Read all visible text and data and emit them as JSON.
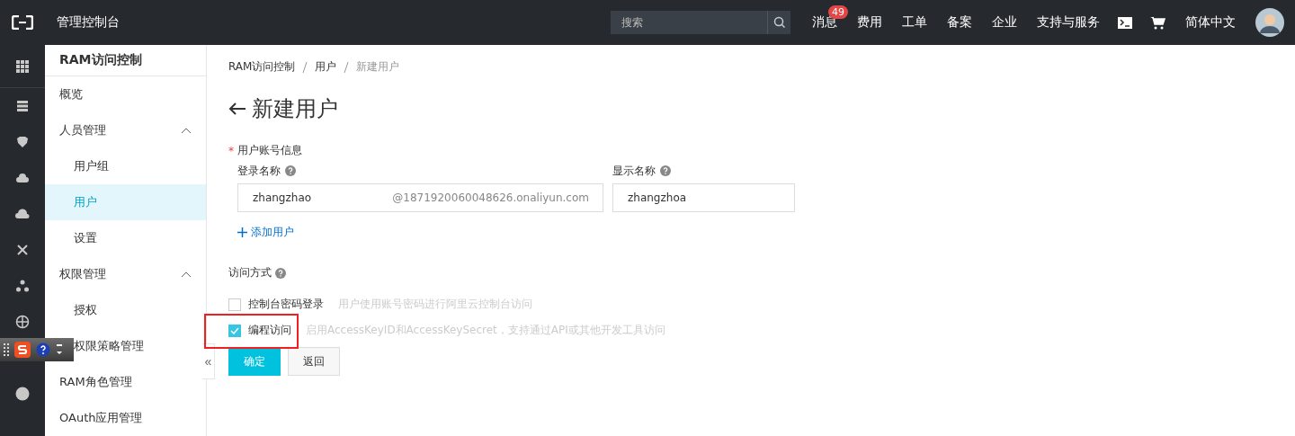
{
  "topbar": {
    "title": "管理控制台",
    "search": {
      "placeholder": "搜索"
    },
    "nav": [
      {
        "label": "消息",
        "badge": "49"
      },
      {
        "label": "费用"
      },
      {
        "label": "工单"
      },
      {
        "label": "备案"
      },
      {
        "label": "企业"
      },
      {
        "label": "支持与服务"
      }
    ],
    "language": "简体中文"
  },
  "sidebar": {
    "title": "RAM访问控制",
    "collapse": "«",
    "items": [
      {
        "label": "概览",
        "selected": false
      },
      {
        "label": "人员管理",
        "selected": false,
        "expanded": true,
        "children": [
          {
            "label": "用户组",
            "selected": false
          },
          {
            "label": "用户",
            "selected": true
          },
          {
            "label": "设置",
            "selected": false
          }
        ]
      },
      {
        "label": "权限管理",
        "selected": false,
        "expanded": true,
        "children": [
          {
            "label": "授权",
            "selected": false
          },
          {
            "label": "权限策略管理",
            "selected": false
          }
        ]
      },
      {
        "label": "RAM角色管理",
        "selected": false
      },
      {
        "label": "OAuth应用管理",
        "selected": false
      }
    ]
  },
  "breadcrumb": [
    "RAM访问控制",
    "用户",
    "新建用户"
  ],
  "page_title": "新建用户",
  "account_section": {
    "required_mark": "*",
    "label": "用户账号信息",
    "login_name": {
      "label": "登录名称",
      "value": "zhangzhao",
      "suffix": "@1871920060048626.onaliyun.com"
    },
    "display_name": {
      "label": "显示名称",
      "value": "zhangzhoa"
    },
    "add_link": "添加用户"
  },
  "access_section": {
    "label": "访问方式",
    "options": [
      {
        "label": "控制台密码登录",
        "hint": "用户使用账号密码进行阿里云控制台访问",
        "checked": false,
        "highlighted": false
      },
      {
        "label": "编程访问",
        "hint": "启用AccessKeyID和AccessKeySecret，支持通过API或其他开发工具访问",
        "checked": true,
        "highlighted": true
      }
    ]
  },
  "buttons": [
    {
      "label": "确定",
      "kind": "primary"
    },
    {
      "label": "返回",
      "kind": "secondary"
    }
  ]
}
